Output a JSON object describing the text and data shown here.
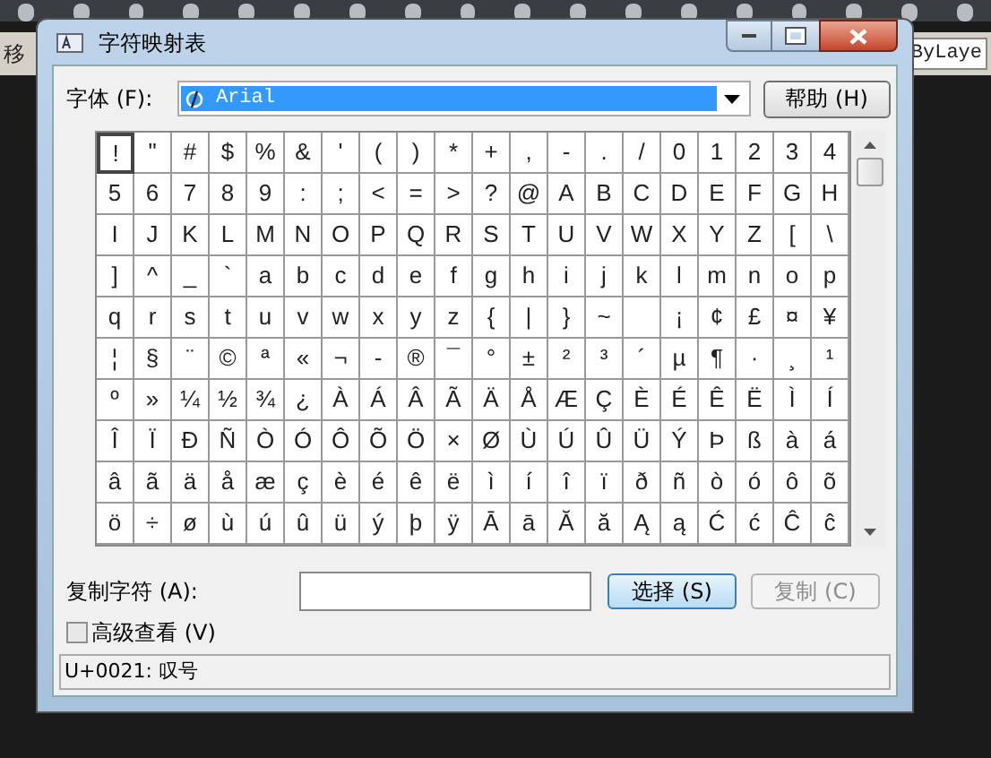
{
  "background_app": {
    "left_label": "移",
    "right_label": "ByLaye"
  },
  "window": {
    "title": "字符映射表"
  },
  "font": {
    "label": "字体 (F):",
    "value": "Arial"
  },
  "help_button": "帮助 (H)",
  "grid": [
    [
      {
        "c": "!",
        "selected": true
      },
      {
        "c": "\"",
        "selected": false
      },
      {
        "c": "#",
        "selected": false
      },
      {
        "c": "$",
        "selected": false
      },
      {
        "c": "%",
        "selected": false
      },
      {
        "c": "&",
        "selected": false
      },
      {
        "c": "'",
        "selected": false
      },
      {
        "c": "(",
        "selected": false
      },
      {
        "c": ")",
        "selected": false
      },
      {
        "c": "*",
        "selected": false
      },
      {
        "c": "+",
        "selected": false
      },
      {
        "c": ",",
        "selected": false
      },
      {
        "c": "-",
        "selected": false
      },
      {
        "c": ".",
        "selected": false
      },
      {
        "c": "/",
        "selected": false
      },
      {
        "c": "0",
        "selected": false
      },
      {
        "c": "1",
        "selected": false
      },
      {
        "c": "2",
        "selected": false
      },
      {
        "c": "3",
        "selected": false
      },
      {
        "c": "4",
        "selected": false
      }
    ],
    [
      {
        "c": "5",
        "selected": false
      },
      {
        "c": "6",
        "selected": false
      },
      {
        "c": "7",
        "selected": false
      },
      {
        "c": "8",
        "selected": false
      },
      {
        "c": "9",
        "selected": false
      },
      {
        "c": ":",
        "selected": false
      },
      {
        "c": ";",
        "selected": false
      },
      {
        "c": "<",
        "selected": false
      },
      {
        "c": "=",
        "selected": false
      },
      {
        "c": ">",
        "selected": false
      },
      {
        "c": "?",
        "selected": false
      },
      {
        "c": "@",
        "selected": false
      },
      {
        "c": "A",
        "selected": false
      },
      {
        "c": "B",
        "selected": false
      },
      {
        "c": "C",
        "selected": false
      },
      {
        "c": "D",
        "selected": false
      },
      {
        "c": "E",
        "selected": false
      },
      {
        "c": "F",
        "selected": false
      },
      {
        "c": "G",
        "selected": false
      },
      {
        "c": "H",
        "selected": false
      }
    ],
    [
      {
        "c": "I",
        "selected": false
      },
      {
        "c": "J",
        "selected": false
      },
      {
        "c": "K",
        "selected": false
      },
      {
        "c": "L",
        "selected": false
      },
      {
        "c": "M",
        "selected": false
      },
      {
        "c": "N",
        "selected": false
      },
      {
        "c": "O",
        "selected": false
      },
      {
        "c": "P",
        "selected": false
      },
      {
        "c": "Q",
        "selected": false
      },
      {
        "c": "R",
        "selected": false
      },
      {
        "c": "S",
        "selected": false
      },
      {
        "c": "T",
        "selected": false
      },
      {
        "c": "U",
        "selected": false
      },
      {
        "c": "V",
        "selected": false
      },
      {
        "c": "W",
        "selected": false
      },
      {
        "c": "X",
        "selected": false
      },
      {
        "c": "Y",
        "selected": false
      },
      {
        "c": "Z",
        "selected": false
      },
      {
        "c": "[",
        "selected": false
      },
      {
        "c": "\\",
        "selected": false
      }
    ],
    [
      {
        "c": "]",
        "selected": false
      },
      {
        "c": "^",
        "selected": false
      },
      {
        "c": "_",
        "selected": false
      },
      {
        "c": "`",
        "selected": false
      },
      {
        "c": "a",
        "selected": false
      },
      {
        "c": "b",
        "selected": false
      },
      {
        "c": "c",
        "selected": false
      },
      {
        "c": "d",
        "selected": false
      },
      {
        "c": "e",
        "selected": false
      },
      {
        "c": "f",
        "selected": false
      },
      {
        "c": "g",
        "selected": false
      },
      {
        "c": "h",
        "selected": false
      },
      {
        "c": "i",
        "selected": false
      },
      {
        "c": "j",
        "selected": false
      },
      {
        "c": "k",
        "selected": false
      },
      {
        "c": "l",
        "selected": false
      },
      {
        "c": "m",
        "selected": false
      },
      {
        "c": "n",
        "selected": false
      },
      {
        "c": "o",
        "selected": false
      },
      {
        "c": "p",
        "selected": false
      }
    ],
    [
      {
        "c": "q",
        "selected": false
      },
      {
        "c": "r",
        "selected": false
      },
      {
        "c": "s",
        "selected": false
      },
      {
        "c": "t",
        "selected": false
      },
      {
        "c": "u",
        "selected": false
      },
      {
        "c": "v",
        "selected": false
      },
      {
        "c": "w",
        "selected": false
      },
      {
        "c": "x",
        "selected": false
      },
      {
        "c": "y",
        "selected": false
      },
      {
        "c": "z",
        "selected": false
      },
      {
        "c": "{",
        "selected": false
      },
      {
        "c": "|",
        "selected": false
      },
      {
        "c": "}",
        "selected": false
      },
      {
        "c": "~",
        "selected": false
      },
      {
        "selected": false
      },
      {
        "c": "¡",
        "selected": false
      },
      {
        "c": "¢",
        "selected": false
      },
      {
        "c": "£",
        "selected": false
      },
      {
        "c": "¤",
        "selected": false
      },
      {
        "c": "¥",
        "selected": false
      }
    ],
    [
      {
        "c": "¦",
        "selected": false
      },
      {
        "c": "§",
        "selected": false
      },
      {
        "c": "¨",
        "selected": false
      },
      {
        "c": "©",
        "selected": false
      },
      {
        "c": "ª",
        "selected": false
      },
      {
        "c": "«",
        "selected": false
      },
      {
        "c": "¬",
        "selected": false
      },
      {
        "c": "-",
        "selected": false
      },
      {
        "c": "®",
        "selected": false
      },
      {
        "c": "¯",
        "selected": false
      },
      {
        "c": "°",
        "selected": false
      },
      {
        "c": "±",
        "selected": false
      },
      {
        "c": "²",
        "selected": false
      },
      {
        "c": "³",
        "selected": false
      },
      {
        "c": "´",
        "selected": false
      },
      {
        "c": "µ",
        "selected": false
      },
      {
        "c": "¶",
        "selected": false
      },
      {
        "c": "·",
        "selected": false
      },
      {
        "c": "¸",
        "selected": false
      },
      {
        "c": "¹",
        "selected": false
      }
    ],
    [
      {
        "c": "º",
        "selected": false
      },
      {
        "c": "»",
        "selected": false
      },
      {
        "c": "¼",
        "selected": false
      },
      {
        "c": "½",
        "selected": false
      },
      {
        "c": "¾",
        "selected": false
      },
      {
        "c": "¿",
        "selected": false
      },
      {
        "c": "À",
        "selected": false
      },
      {
        "c": "Á",
        "selected": false
      },
      {
        "c": "Â",
        "selected": false
      },
      {
        "c": "Ã",
        "selected": false
      },
      {
        "c": "Ä",
        "selected": false
      },
      {
        "c": "Å",
        "selected": false
      },
      {
        "c": "Æ",
        "selected": false
      },
      {
        "c": "Ç",
        "selected": false
      },
      {
        "c": "È",
        "selected": false
      },
      {
        "c": "É",
        "selected": false
      },
      {
        "c": "Ê",
        "selected": false
      },
      {
        "c": "Ë",
        "selected": false
      },
      {
        "c": "Ì",
        "selected": false
      },
      {
        "c": "Í",
        "selected": false
      }
    ],
    [
      {
        "c": "Î",
        "selected": false
      },
      {
        "c": "Ï",
        "selected": false
      },
      {
        "c": "Ð",
        "selected": false
      },
      {
        "c": "Ñ",
        "selected": false
      },
      {
        "c": "Ò",
        "selected": false
      },
      {
        "c": "Ó",
        "selected": false
      },
      {
        "c": "Ô",
        "selected": false
      },
      {
        "c": "Õ",
        "selected": false
      },
      {
        "c": "Ö",
        "selected": false
      },
      {
        "c": "×",
        "selected": false
      },
      {
        "c": "Ø",
        "selected": false
      },
      {
        "c": "Ù",
        "selected": false
      },
      {
        "c": "Ú",
        "selected": false
      },
      {
        "c": "Û",
        "selected": false
      },
      {
        "c": "Ü",
        "selected": false
      },
      {
        "c": "Ý",
        "selected": false
      },
      {
        "c": "Þ",
        "selected": false
      },
      {
        "c": "ß",
        "selected": false
      },
      {
        "c": "à",
        "selected": false
      },
      {
        "c": "á",
        "selected": false
      }
    ],
    [
      {
        "c": "â",
        "selected": false
      },
      {
        "c": "ã",
        "selected": false
      },
      {
        "c": "ä",
        "selected": false
      },
      {
        "c": "å",
        "selected": false
      },
      {
        "c": "æ",
        "selected": false
      },
      {
        "c": "ç",
        "selected": false
      },
      {
        "c": "è",
        "selected": false
      },
      {
        "c": "é",
        "selected": false
      },
      {
        "c": "ê",
        "selected": false
      },
      {
        "c": "ë",
        "selected": false
      },
      {
        "c": "ì",
        "selected": false
      },
      {
        "c": "í",
        "selected": false
      },
      {
        "c": "î",
        "selected": false
      },
      {
        "c": "ï",
        "selected": false
      },
      {
        "c": "ð",
        "selected": false
      },
      {
        "c": "ñ",
        "selected": false
      },
      {
        "c": "ò",
        "selected": false
      },
      {
        "c": "ó",
        "selected": false
      },
      {
        "c": "ô",
        "selected": false
      },
      {
        "c": "õ",
        "selected": false
      }
    ],
    [
      {
        "c": "ö",
        "selected": false
      },
      {
        "c": "÷",
        "selected": false
      },
      {
        "c": "ø",
        "selected": false
      },
      {
        "c": "ù",
        "selected": false
      },
      {
        "c": "ú",
        "selected": false
      },
      {
        "c": "û",
        "selected": false
      },
      {
        "c": "ü",
        "selected": false
      },
      {
        "c": "ý",
        "selected": false
      },
      {
        "c": "þ",
        "selected": false
      },
      {
        "c": "ÿ",
        "selected": false
      },
      {
        "c": "Ā",
        "selected": false
      },
      {
        "c": "ā",
        "selected": false
      },
      {
        "c": "Ă",
        "selected": false
      },
      {
        "c": "ă",
        "selected": false
      },
      {
        "c": "Ą",
        "selected": false
      },
      {
        "c": "ą",
        "selected": false
      },
      {
        "c": "Ć",
        "selected": false
      },
      {
        "c": "ć",
        "selected": false
      },
      {
        "c": "Ĉ",
        "selected": false
      },
      {
        "c": "ĉ",
        "selected": false
      }
    ]
  ],
  "copy": {
    "label": "复制字符 (A):",
    "select_button": "选择 (S)",
    "copy_button": {
      "label": "复制 (C)",
      "disabled": true
    }
  },
  "advanced": {
    "label": "高级查看 (V)",
    "checked": false
  },
  "status_bar": "U+0021: 叹号"
}
